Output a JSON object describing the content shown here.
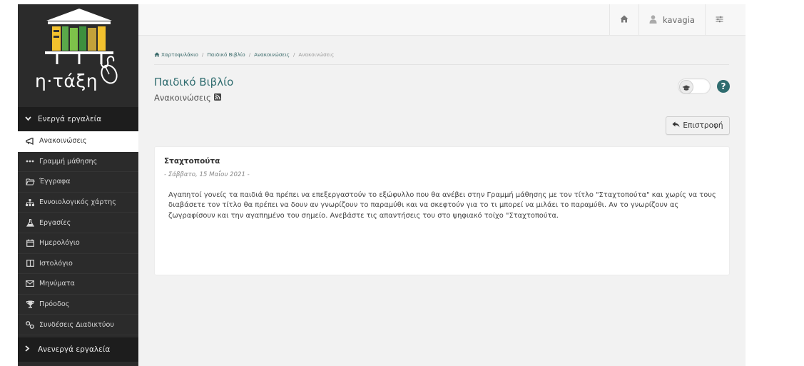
{
  "app": {
    "logo_text": "η·τάξη"
  },
  "sidebar": {
    "active_section": "Ενεργά εργαλεία",
    "items": [
      {
        "label": "Ανακοινώσεις",
        "icon": "bullhorn-icon",
        "active": true
      },
      {
        "label": "Γραμμή μάθησης",
        "icon": "ellipsis-icon",
        "active": false
      },
      {
        "label": "Έγγραφα",
        "icon": "folder-open-icon",
        "active": false
      },
      {
        "label": "Εννοιολογικός χάρτης",
        "icon": "sitemap-icon",
        "active": false
      },
      {
        "label": "Εργασίες",
        "icon": "flask-icon",
        "active": false
      },
      {
        "label": "Ημερολόγιο",
        "icon": "calendar-icon",
        "active": false
      },
      {
        "label": "Ιστολόγιο",
        "icon": "columns-icon",
        "active": false
      },
      {
        "label": "Μηνύματα",
        "icon": "envelope-icon",
        "active": false
      },
      {
        "label": "Πρόοδος",
        "icon": "trophy-icon",
        "active": false
      },
      {
        "label": "Συνδέσεις Διαδικτύου",
        "icon": "link-icon",
        "active": false
      }
    ],
    "inactive_section": "Ανενεργά εργαλεία"
  },
  "topbar": {
    "username": "kavagia"
  },
  "breadcrumb": {
    "items": [
      "Χαρτοφυλάκιο",
      "Παιδικό Βιβλίο",
      "Ανακοινώσεις",
      "Ανακοινώσεις"
    ],
    "separator": "/"
  },
  "page": {
    "title": "Παιδικό Βιβλίο",
    "subtitle": "Ανακοινώσεις",
    "help": "?",
    "back_label": "Επιστροφή"
  },
  "announcement": {
    "title": "Σταχτοπούτα",
    "date": "- Σάββατο, 15 Μαΐου 2021 -",
    "body": "Αγαπητοί γονείς τα παιδιά θα πρέπει να επεξεργαστούν το εξώφυλλο που θα ανέβει στην Γραμμή μάθησης με τον τίτλο \"Σταχτοπούτα\" και χωρίς να τους διαβάσετε τον τίτλο θα πρέπει να δουν αν γνωρίζουν το παραμύθι και να σκεφτούν για το τι μπορεί να μιλάει το παραμύθι. Αν το γνωρίζουν ας ζωγραφίσουν και την αγαπημένο του σημείο. Ανεβάστε τις απαντήσεις του στο ψηφιακό τοίχο \"Σταχτοπούτα."
  },
  "colors": {
    "sidebar_bg": "#2b2b2b",
    "section_bg": "#1d1d1d",
    "accent": "#2f6c6f",
    "main_bg": "#f2f2f2"
  }
}
